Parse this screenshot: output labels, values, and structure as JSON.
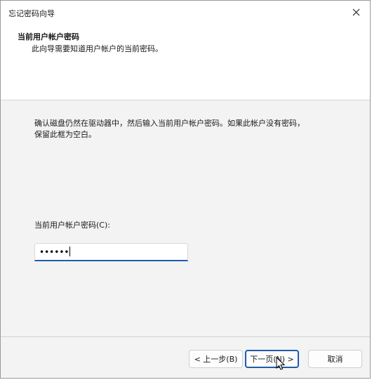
{
  "window": {
    "title": "忘记密码向导"
  },
  "header": {
    "title": "当前用户帐户密码",
    "subtitle": "此向导需要知道用户帐户的当前密码。"
  },
  "content": {
    "instruction_line1": "确认磁盘仍然在驱动器中，然后输入当前用户帐户密码。如果此帐户没有密码，",
    "instruction_line2": "保留此框为空白。",
    "password_label": "当前用户帐户密码(C):",
    "password_value": "••••••"
  },
  "buttons": {
    "back": "< 上一步(B)",
    "next": "下一页(N) >",
    "cancel": "取消"
  },
  "colors": {
    "accent": "#1f5ca8"
  }
}
